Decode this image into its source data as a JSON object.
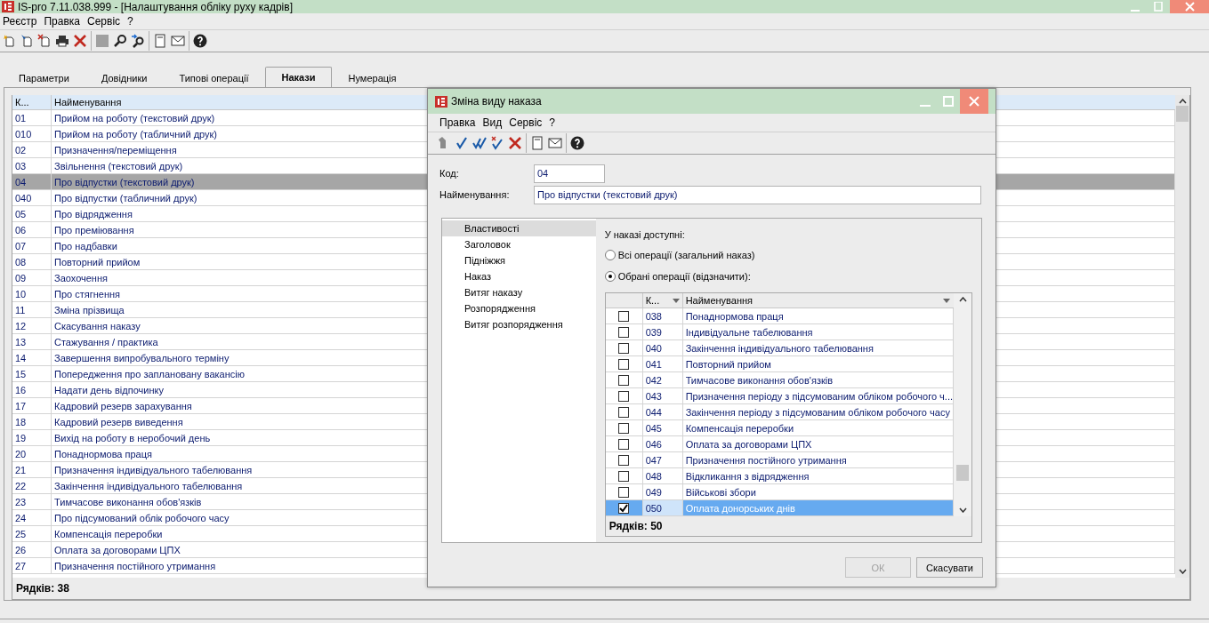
{
  "window": {
    "title": "IS-pro 7.11.038.999 - [Налаштування обліку руху кадрів]"
  },
  "menu": [
    "Реєстр",
    "Правка",
    "Сервіс",
    "?"
  ],
  "tabs": [
    {
      "label": "Параметри",
      "selected": false
    },
    {
      "label": "Довідники",
      "selected": false
    },
    {
      "label": "Типові операції",
      "selected": false
    },
    {
      "label": "Накази",
      "selected": true
    },
    {
      "label": "Нумерація",
      "selected": false
    }
  ],
  "table": {
    "columns": [
      "К...",
      "Найменування"
    ],
    "rows": [
      {
        "code": "01",
        "name": "Прийом на роботу (текстовий друк)",
        "selected": false
      },
      {
        "code": "010",
        "name": "Прийом на роботу (табличний друк)",
        "selected": false
      },
      {
        "code": "02",
        "name": "Призначення/переміщення",
        "selected": false
      },
      {
        "code": "03",
        "name": "Звільнення (текстовий друк)",
        "selected": false
      },
      {
        "code": "04",
        "name": "Про відпустки (текстовий друк)",
        "selected": true
      },
      {
        "code": "040",
        "name": "Про відпустки (табличний друк)",
        "selected": false
      },
      {
        "code": "05",
        "name": "Про відрядження",
        "selected": false
      },
      {
        "code": "06",
        "name": "Про преміювання",
        "selected": false
      },
      {
        "code": "07",
        "name": "Про надбавки",
        "selected": false
      },
      {
        "code": "08",
        "name": "Повторний прийом",
        "selected": false
      },
      {
        "code": "09",
        "name": "Заохочення",
        "selected": false
      },
      {
        "code": "10",
        "name": "Про стягнення",
        "selected": false
      },
      {
        "code": "11",
        "name": "Зміна прізвища",
        "selected": false
      },
      {
        "code": "12",
        "name": "Скасування наказу",
        "selected": false
      },
      {
        "code": "13",
        "name": "Стажування / практика",
        "selected": false
      },
      {
        "code": "14",
        "name": "Завершення випробувального терміну",
        "selected": false
      },
      {
        "code": "15",
        "name": "Попередження про заплановану вакансію",
        "selected": false
      },
      {
        "code": "16",
        "name": "Надати день відпочинку",
        "selected": false
      },
      {
        "code": "17",
        "name": "Кадровий резерв зарахування",
        "selected": false
      },
      {
        "code": "18",
        "name": "Кадровий резерв виведення",
        "selected": false
      },
      {
        "code": "19",
        "name": "Вихід на роботу в неробочий день",
        "selected": false
      },
      {
        "code": "20",
        "name": "Понаднормова праця",
        "selected": false
      },
      {
        "code": "21",
        "name": "Призначення індивідуального табелювання",
        "selected": false
      },
      {
        "code": "22",
        "name": "Закінчення індивідуального табелювання",
        "selected": false
      },
      {
        "code": "23",
        "name": "Тимчасове виконання обов'язків",
        "selected": false
      },
      {
        "code": "24",
        "name": "Про підсумований облік робочого часу",
        "selected": false
      },
      {
        "code": "25",
        "name": "Компенсація переробки",
        "selected": false
      },
      {
        "code": "26",
        "name": "Оплата за договорами ЦПХ",
        "selected": false
      },
      {
        "code": "27",
        "name": "Призначення постійного утримання",
        "selected": false
      }
    ],
    "footer": "Рядків: 38"
  },
  "dialog": {
    "title": "Зміна виду наказа",
    "menu": [
      "Правка",
      "Вид",
      "Сервіс",
      "?"
    ],
    "fields": [
      {
        "label": "Код:",
        "value": "04"
      },
      {
        "label": "Найменування:",
        "value": "Про відпустки (текстовий друк)"
      }
    ],
    "sections": [
      {
        "label": "Властивості",
        "selected": true
      },
      {
        "label": "Заголовок",
        "selected": false
      },
      {
        "label": "Підніжжя",
        "selected": false
      },
      {
        "label": "Наказ",
        "selected": false
      },
      {
        "label": "Витяг наказу",
        "selected": false
      },
      {
        "label": "Розпорядження",
        "selected": false
      },
      {
        "label": "Витяг розпорядження",
        "selected": false
      }
    ],
    "available_label": "У наказі доступні:",
    "options": [
      {
        "label": "Всі операції (загальний наказ)",
        "selected": false
      },
      {
        "label": "Обрані операції (відзначити):",
        "selected": true
      }
    ],
    "grid": {
      "columns": [
        "К...",
        "Найменування"
      ],
      "rows": [
        {
          "code": "038",
          "name": "Понаднормова праця",
          "checked": false,
          "selected": false
        },
        {
          "code": "039",
          "name": "Індивідуальне табелювання",
          "checked": false,
          "selected": false
        },
        {
          "code": "040",
          "name": "Закінчення індивідуального табелювання",
          "checked": false,
          "selected": false
        },
        {
          "code": "041",
          "name": "Повторний прийом",
          "checked": false,
          "selected": false
        },
        {
          "code": "042",
          "name": "Тимчасове виконання обов'язків",
          "checked": false,
          "selected": false
        },
        {
          "code": "043",
          "name": "Призначення періоду з підсумованим обліком робочого ч...",
          "checked": false,
          "selected": false
        },
        {
          "code": "044",
          "name": "Закінчення періоду з підсумованим обліком робочого часу",
          "checked": false,
          "selected": false
        },
        {
          "code": "045",
          "name": "Компенсація переробки",
          "checked": false,
          "selected": false
        },
        {
          "code": "046",
          "name": "Оплата за договорами ЦПХ",
          "checked": false,
          "selected": false
        },
        {
          "code": "047",
          "name": "Призначення постійного утримання",
          "checked": false,
          "selected": false
        },
        {
          "code": "048",
          "name": "Відкликання з відрядження",
          "checked": false,
          "selected": false
        },
        {
          "code": "049",
          "name": "Військові збори",
          "checked": false,
          "selected": false
        },
        {
          "code": "050",
          "name": "Оплата донорських днів",
          "checked": true,
          "selected": true
        }
      ],
      "footer": "Рядків: 50"
    },
    "buttons": [
      {
        "label": "ОК",
        "disabled": true
      },
      {
        "label": "Скасувати",
        "disabled": false
      }
    ]
  }
}
